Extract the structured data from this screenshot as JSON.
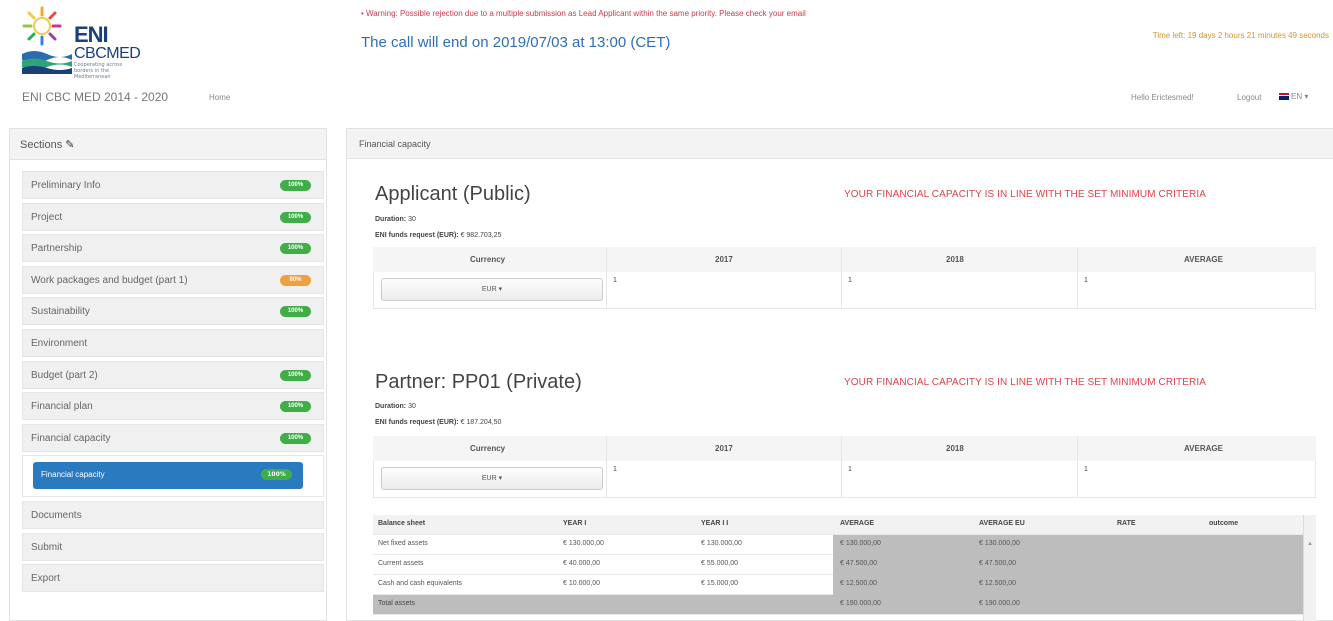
{
  "header": {
    "logo_brand": "ENI",
    "logo_brand2": "CBCMED",
    "logo_tagline": "Cooperating across borders in the Mediterranean",
    "warning": "• Warning: Possible rejection due to a multiple submission as Lead Applicant within the same priority. Please check your email",
    "call_end": "The call will end on 2019/07/03 at 13:00 (CET)",
    "time_left": "Time left: 19 days 2 hours 21 minutes 49 seconds"
  },
  "navbar": {
    "title": "ENI CBC MED 2014 - 2020",
    "home": "Home",
    "hello": "Hello Erictesmed!",
    "logout": "Logout",
    "lang": "EN"
  },
  "sidebar": {
    "title": "Sections",
    "items": [
      {
        "label": "Preliminary Info",
        "badge": "100%",
        "color": "green"
      },
      {
        "label": "Project",
        "badge": "100%",
        "color": "green"
      },
      {
        "label": "Partnership",
        "badge": "100%",
        "color": "green"
      },
      {
        "label": "Work packages and budget (part 1)",
        "badge": "80%",
        "color": "orange"
      },
      {
        "label": "Sustainability",
        "badge": "100%",
        "color": "green"
      },
      {
        "label": "Environment",
        "badge": "",
        "color": ""
      },
      {
        "label": "Budget (part 2)",
        "badge": "100%",
        "color": "green"
      },
      {
        "label": "Financial plan",
        "badge": "100%",
        "color": "green"
      },
      {
        "label": "Financial capacity",
        "badge": "100%",
        "color": "green"
      }
    ],
    "sub_item": {
      "label": "Financial capacity",
      "badge": "100%"
    },
    "items_after": [
      {
        "label": "Documents"
      },
      {
        "label": "Submit"
      },
      {
        "label": "Export"
      }
    ]
  },
  "main": {
    "title": "Financial capacity",
    "applicant": {
      "title": "Applicant (Public)",
      "message": "YOUR FINANCIAL CAPACITY IS IN LINE WITH THE SET MINIMUM CRITERIA",
      "duration_label": "Duration:",
      "duration_value": "30",
      "funds_label": "ENI funds request (EUR):",
      "funds_value": "€ 982.703,25",
      "table": {
        "headers": [
          "Currency",
          "2017",
          "2018",
          "AVERAGE"
        ],
        "currency": "EUR ▾",
        "values": [
          "1",
          "1",
          "1"
        ]
      }
    },
    "partner": {
      "title": "Partner:  PP01 (Private)",
      "message": "YOUR FINANCIAL CAPACITY IS IN LINE WITH THE SET MINIMUM CRITERIA",
      "duration_label": "Duration:",
      "duration_value": "30",
      "funds_label": "ENI funds request (EUR):",
      "funds_value": "€ 187.204,50",
      "table": {
        "headers": [
          "Currency",
          "2017",
          "2018",
          "AVERAGE"
        ],
        "currency": "EUR ▾",
        "values": [
          "1",
          "1",
          "1"
        ]
      }
    },
    "balance_sheet": {
      "headers": [
        "Balance sheet",
        "YEAR I",
        "YEAR I I",
        "AVERAGE",
        "AVERAGE EU",
        "RATE",
        "outcome"
      ],
      "rows": [
        [
          "Net fixed assets",
          "€ 130.000,00",
          "€ 130.000,00",
          "€ 130.000,00",
          "€ 130.000,00",
          "",
          ""
        ],
        [
          "Current assets",
          "€ 40.000,00",
          "€ 55.000,00",
          "€ 47.500,00",
          "€ 47.500,00",
          "",
          ""
        ],
        [
          "Cash and cash equivalents",
          "€ 10.000,00",
          "€ 15.000,00",
          "€ 12.500,00",
          "€ 12.500,00",
          "",
          ""
        ],
        [
          "Total assets",
          "",
          "",
          "€ 190.000,00",
          "€ 190.000,00",
          "",
          ""
        ]
      ]
    }
  }
}
